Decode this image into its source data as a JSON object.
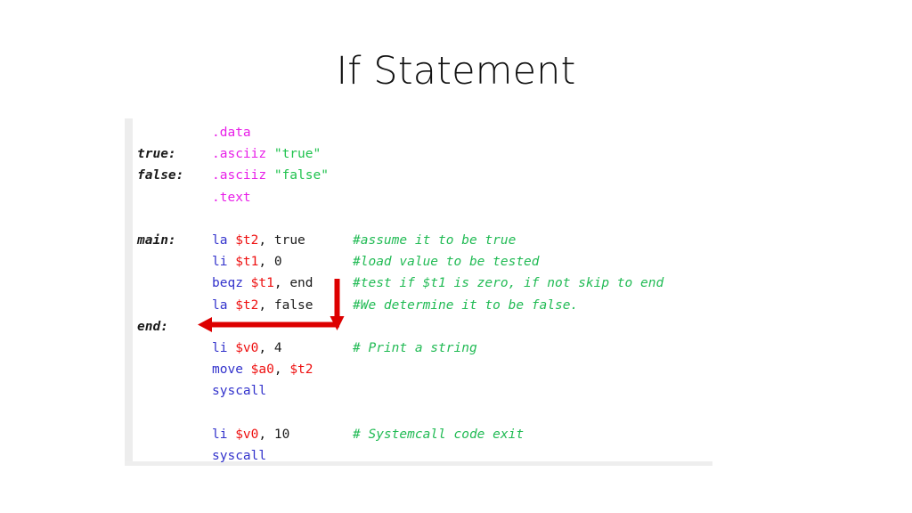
{
  "slide": {
    "title": "If Statement"
  },
  "code_block": {
    "language": "MIPS assembly",
    "colors": {
      "directive": "#e81ee8",
      "string": "#1fc24d",
      "mnemonic": "#3333cc",
      "register": "#ee1111",
      "comment": "#22bb55",
      "label": "#1a1a1a",
      "plain": "#1a1a1a",
      "arrow": "#dd0000",
      "background": "#ffffff"
    },
    "lines": [
      {
        "label": "",
        "tokens": [
          {
            "t": ".data",
            "c": "directive"
          }
        ],
        "comment": ""
      },
      {
        "label": "true:",
        "tokens": [
          {
            "t": ".asciiz ",
            "c": "directive"
          },
          {
            "t": "\"true\"",
            "c": "string"
          }
        ],
        "comment": ""
      },
      {
        "label": "false:",
        "tokens": [
          {
            "t": ".asciiz ",
            "c": "directive"
          },
          {
            "t": "\"false\"",
            "c": "string"
          }
        ],
        "comment": ""
      },
      {
        "label": "",
        "tokens": [
          {
            "t": ".text",
            "c": "directive"
          }
        ],
        "comment": ""
      },
      {
        "label": "",
        "tokens": [],
        "comment": "",
        "blank": true
      },
      {
        "label": "main:",
        "tokens": [
          {
            "t": "la ",
            "c": "mnemonic"
          },
          {
            "t": "$t2",
            "c": "register"
          },
          {
            "t": ", true",
            "c": "plain"
          }
        ],
        "comment": "#assume it to be true"
      },
      {
        "label": "",
        "tokens": [
          {
            "t": "li ",
            "c": "mnemonic"
          },
          {
            "t": "$t1",
            "c": "register"
          },
          {
            "t": ", 0",
            "c": "plain"
          }
        ],
        "comment": "#load value to be tested"
      },
      {
        "label": "",
        "tokens": [
          {
            "t": "beqz ",
            "c": "mnemonic"
          },
          {
            "t": "$t1",
            "c": "register"
          },
          {
            "t": ", end",
            "c": "plain"
          }
        ],
        "comment": "#test if $t1 is zero, if not skip to end"
      },
      {
        "label": "",
        "tokens": [
          {
            "t": "la ",
            "c": "mnemonic"
          },
          {
            "t": "$t2",
            "c": "register"
          },
          {
            "t": ", false",
            "c": "plain"
          }
        ],
        "comment": "#We determine it to be false."
      },
      {
        "label": "end:",
        "tokens": [],
        "comment": ""
      },
      {
        "label": "",
        "tokens": [
          {
            "t": "li ",
            "c": "mnemonic"
          },
          {
            "t": "$v0",
            "c": "register"
          },
          {
            "t": ", 4",
            "c": "plain"
          }
        ],
        "comment": "# Print a string"
      },
      {
        "label": "",
        "tokens": [
          {
            "t": "move ",
            "c": "mnemonic"
          },
          {
            "t": "$a0",
            "c": "register"
          },
          {
            "t": ", ",
            "c": "plain"
          },
          {
            "t": "$t2",
            "c": "register"
          }
        ],
        "comment": ""
      },
      {
        "label": "",
        "tokens": [
          {
            "t": "syscall",
            "c": "mnemonic"
          }
        ],
        "comment": ""
      },
      {
        "label": "",
        "tokens": [],
        "comment": "",
        "blank": true
      },
      {
        "label": "",
        "tokens": [
          {
            "t": "li ",
            "c": "mnemonic"
          },
          {
            "t": "$v0",
            "c": "register"
          },
          {
            "t": ", 10",
            "c": "plain"
          }
        ],
        "comment": "# Systemcall code exit"
      },
      {
        "label": "",
        "tokens": [
          {
            "t": "syscall",
            "c": "mnemonic"
          }
        ],
        "comment": ""
      }
    ]
  },
  "annotation": {
    "arrow_name": "branch-jump-arrow",
    "description": "Red arrow from the beqz line jumping down and left to the end: label"
  }
}
